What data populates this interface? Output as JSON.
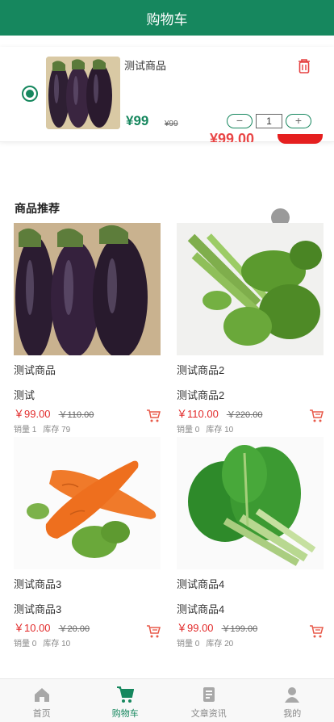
{
  "header": {
    "title": "购物车"
  },
  "cart": {
    "item": {
      "title": "测试商品",
      "price": "¥99",
      "old_price": "¥99",
      "quantity": "1",
      "minus": "−",
      "plus": "+"
    },
    "ghost_total": "¥99.00"
  },
  "recommend": {
    "title": "商品推荐",
    "products": [
      {
        "name": "测试商品",
        "subtitle": "测试",
        "price": "￥99.00",
        "old_price": "￥110.00",
        "sales": "销量 1",
        "stock": "库存 79",
        "image": "eggplant"
      },
      {
        "name": "测试商品2",
        "subtitle": "测试商品2",
        "price": "￥110.00",
        "old_price": "￥220.00",
        "sales": "销量 0",
        "stock": "库存 10",
        "image": "celery"
      },
      {
        "name": "测试商品3",
        "subtitle": "测试商品3",
        "price": "￥10.00",
        "old_price": "￥20.00",
        "sales": "销量 0",
        "stock": "库存 10",
        "image": "carrot"
      },
      {
        "name": "测试商品4",
        "subtitle": "测试商品4",
        "price": "￥99.00",
        "old_price": "￥199.00",
        "sales": "销量 0",
        "stock": "库存 20",
        "image": "greens"
      }
    ]
  },
  "tabbar": {
    "tabs": [
      {
        "label": "首页",
        "icon": "home-icon"
      },
      {
        "label": "购物车",
        "icon": "cart-icon"
      },
      {
        "label": "文章资讯",
        "icon": "article-icon"
      },
      {
        "label": "我的",
        "icon": "user-icon"
      }
    ],
    "active_index": 1
  },
  "colors": {
    "brand": "#16875e",
    "price": "#e22b2b"
  }
}
